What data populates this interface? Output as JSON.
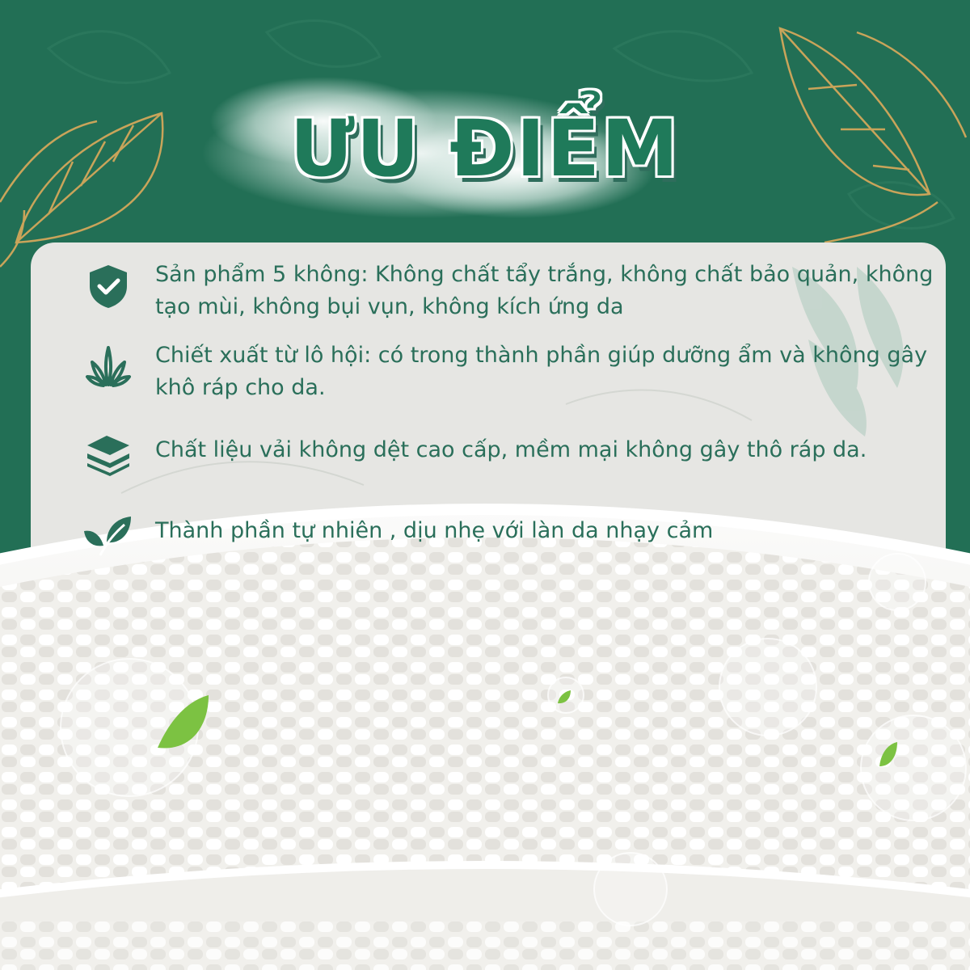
{
  "title": "ƯU ĐIỂM",
  "colors": {
    "background": "#1f6b52",
    "panel": "#e6e6e3",
    "text": "#2a6f5a",
    "gold": "#c9a45a"
  },
  "items": [
    {
      "icon": "shield-check-icon",
      "text": "Sản phẩm 5 không: Không chất tẩy trắng, không chất bảo quản, không tạo mùi, không bụi vụn, không kích ứng da"
    },
    {
      "icon": "aloe-icon",
      "text": "Chiết xuất từ lô hội: có trong thành phần giúp dưỡng ẩm và không gây khô ráp cho da."
    },
    {
      "icon": "fabric-layers-icon",
      "text": "Chất liệu vải không dệt cao cấp, mềm mại không gây thô ráp da."
    },
    {
      "icon": "leaf-icon",
      "text": "Thành phần tự nhiên , dịu nhẹ với làn da nhạy cảm"
    }
  ]
}
